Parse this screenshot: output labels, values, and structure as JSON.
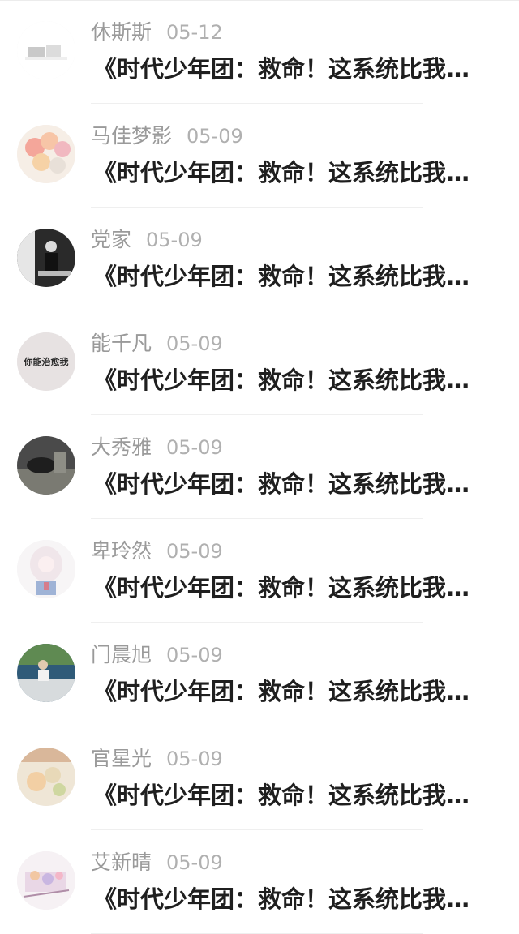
{
  "comments": [
    {
      "name": "休斯斯",
      "date": "05-12",
      "title": "《时代少年团：救命！这系统比我…",
      "avatar": "avatar-gray-car"
    },
    {
      "name": "马佳梦影",
      "date": "05-09",
      "title": "《时代少年团：救命！这系统比我…",
      "avatar": "avatar-balloons"
    },
    {
      "name": "党家",
      "date": "05-09",
      "title": "《时代少年团：救命！这系统比我…",
      "avatar": "avatar-bw-person"
    },
    {
      "name": "能千凡",
      "date": "05-09",
      "title": "《时代少年团：救命！这系统比我…",
      "avatar": "avatar-text",
      "avatar_text": "你能治愈我"
    },
    {
      "name": "大秀雅",
      "date": "05-09",
      "title": "《时代少年团：救命！这系统比我…",
      "avatar": "avatar-bw-landscape"
    },
    {
      "name": "卑玲然",
      "date": "05-09",
      "title": "《时代少年团：救命！这系统比我…",
      "avatar": "avatar-anime-girl"
    },
    {
      "name": "门晨旭",
      "date": "05-09",
      "title": "《时代少年团：救命！这系统比我…",
      "avatar": "avatar-lake-person"
    },
    {
      "name": "官星光",
      "date": "05-09",
      "title": "《时代少年团：救命！这系统比我…",
      "avatar": "avatar-flowers"
    },
    {
      "name": "艾新晴",
      "date": "05-09",
      "title": "《时代少年团：救命！这系统比我…",
      "avatar": "avatar-pastel-sketch"
    }
  ]
}
